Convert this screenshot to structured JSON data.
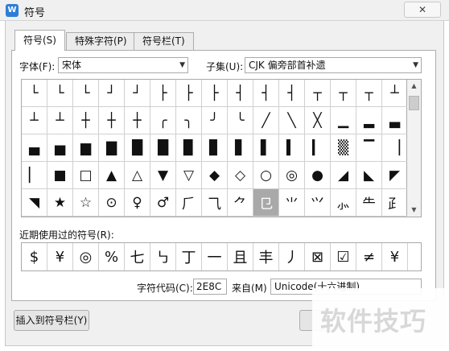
{
  "window": {
    "title": "符号",
    "app_icon_glyph": "W",
    "close_glyph": "✕"
  },
  "tabs": [
    {
      "label": "符号(S)",
      "active": true
    },
    {
      "label": "特殊字符(P)",
      "active": false
    },
    {
      "label": "符号栏(T)",
      "active": false
    }
  ],
  "font": {
    "label": "字体(F):",
    "value": "宋体"
  },
  "subset": {
    "label": "子集(U):",
    "value": "CJK 偏旁部首补遗"
  },
  "symbols": [
    "└",
    "└",
    "└",
    "┘",
    "┘",
    "├",
    "├",
    "├",
    "┤",
    "┤",
    "┤",
    "┬",
    "┬",
    "┬",
    "┴",
    "┴",
    "┴",
    "┼",
    "┼",
    "┼",
    "╭",
    "╮",
    "╯",
    "╰",
    "╱",
    "╲",
    "╳",
    "▁",
    "▂",
    "▃",
    "▄",
    "▅",
    "▆",
    "▇",
    "█",
    "█",
    "▉",
    "▊",
    "▋",
    "▌",
    "▍",
    "▎",
    "▒",
    "▔",
    "▕",
    "▏",
    "■",
    "□",
    "▲",
    "△",
    "▼",
    "▽",
    "◆",
    "◇",
    "○",
    "◎",
    "●",
    "◢",
    "◣",
    "◤",
    "◥",
    "★",
    "☆",
    "⊙",
    "♀",
    "♂",
    "⺁",
    "⺄",
    "⺈",
    "⺋",
    "⺌",
    "⺍",
    "⺗",
    "⺧",
    "⺪"
  ],
  "selected_index": 69,
  "recent": {
    "label": "近期使用过的符号(R):",
    "items": [
      "$",
      "¥",
      "◎",
      "%",
      "七",
      "㇉",
      "丁",
      "一",
      "且",
      "丰",
      "丿",
      "⊠",
      "☑",
      "≠",
      "¥"
    ]
  },
  "char_code": {
    "label": "字符代码(C):",
    "value": "2E8C"
  },
  "from": {
    "label": "来自(M)",
    "value": "Unicode(十六进制)"
  },
  "insert_button": "插入到符号栏(Y)",
  "watermark": "软件技巧"
}
